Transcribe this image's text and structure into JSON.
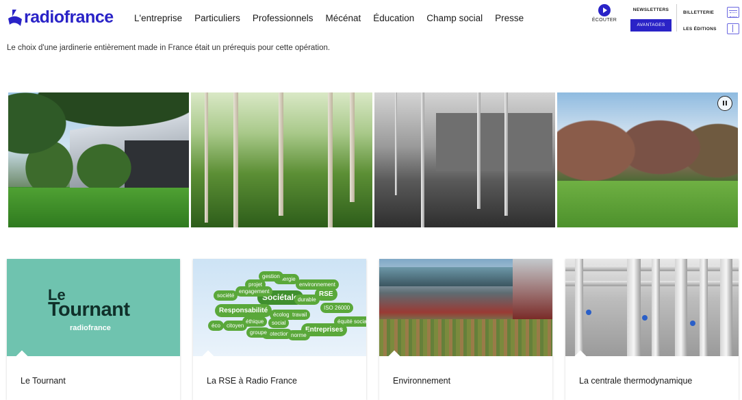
{
  "header": {
    "logo_text": "radiofrance",
    "nav": [
      "L'entreprise",
      "Particuliers",
      "Professionnels",
      "Mécénat",
      "Éducation",
      "Champ social",
      "Presse"
    ],
    "listen_label": "ÉCOUTER",
    "newsletters_label": "NEWSLETTERS",
    "avantages_label": "AVANTAGES",
    "billetterie_label": "BILLETTERIE",
    "editions_label": "LES ÉDITIONS"
  },
  "caption": "Le choix d'une jardinerie entièrement made in France était un prérequis pour cette opération.",
  "cards": [
    {
      "title": "Le Tournant",
      "image_text": {
        "le": "Le",
        "big": "Tournant",
        "brand": "radiofrance"
      }
    },
    {
      "title": "La RSE à Radio France",
      "words": [
        "Sociétale",
        "Responsabilité",
        "RSE",
        "Entreprises",
        "durable",
        "citoyen",
        "éco",
        "écologie",
        "protection",
        "ISO 26000",
        "équité sociale",
        "énergie",
        "gestion",
        "engagement",
        "société",
        "environnement",
        "éthique",
        "social",
        "travail",
        "groupe",
        "norme",
        "projet"
      ]
    },
    {
      "title": "Environnement"
    },
    {
      "title": "La centrale thermodynamique"
    }
  ],
  "colors": {
    "brand": "#2a23c7",
    "tournant_bg": "#6fc3af"
  }
}
